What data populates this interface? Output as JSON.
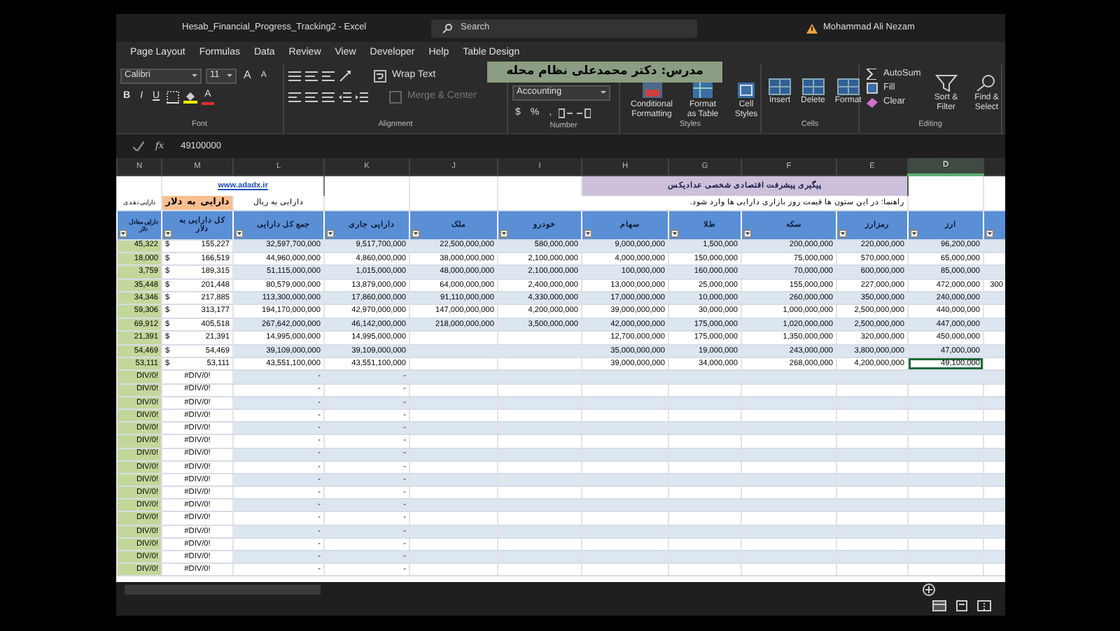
{
  "window": {
    "title": "Hesab_Financial_Progress_Tracking2 - Excel"
  },
  "search": {
    "placeholder": "Search"
  },
  "account": {
    "name": "Mohammad Ali Nezam"
  },
  "ribbon_tabs": [
    {
      "label": "Page Layout"
    },
    {
      "label": "Formulas"
    },
    {
      "label": "Data"
    },
    {
      "label": "Review"
    },
    {
      "label": "View"
    },
    {
      "label": "Developer"
    },
    {
      "label": "Help"
    },
    {
      "label": "Table Design"
    }
  ],
  "instructor_caption": "مدرس: دکتر محمدعلی نظام محله",
  "font_group": {
    "label": "Font",
    "font_name": "Calibri",
    "font_size": "11",
    "grow": "A",
    "shrink": "A",
    "bold": "B",
    "italic": "I",
    "underline": "U",
    "font_color": "A"
  },
  "alignment_group": {
    "label": "Alignment",
    "wrap_text": "Wrap Text",
    "merge": "Merge & Center",
    "merge_disabled": true
  },
  "number_group": {
    "label": "Number",
    "format": "Accounting",
    "currency": "$",
    "percent": "%",
    "comma": ","
  },
  "styles_group": {
    "label": "Styles",
    "buttons": [
      "Conditional Formatting",
      "Format as Table",
      "Cell Styles"
    ]
  },
  "cells_group": {
    "label": "Cells",
    "buttons": [
      "Insert",
      "Delete",
      "Format"
    ]
  },
  "editing_group": {
    "label": "Editing",
    "small_buttons": [
      {
        "kind": "sum",
        "label": "AutoSum"
      },
      {
        "kind": "fill",
        "label": "Fill"
      },
      {
        "kind": "clear",
        "label": "Clear"
      }
    ],
    "large_buttons": [
      {
        "kind": "sort",
        "label": "Sort & Filter"
      },
      {
        "kind": "find",
        "label": "Find & Select"
      }
    ]
  },
  "formula_bar": {
    "function_label": "fx",
    "value": "49100000"
  },
  "sheet": {
    "banner_link": "www.adadx.ir",
    "banner_title": "پیگیری پیشرفت اقتصادی شخصی عدادیکس",
    "note": "راهنما: در این ستون ها قیمت روز بازاری دارایی ها وارد شود.",
    "columns": [
      {
        "label": "N",
        "selected": false,
        "subheader": "دارایی نقدی",
        "heading": "دارایی معادل دلار"
      },
      {
        "label": "M",
        "selected": false,
        "subheader": "دارایی به دلار",
        "heading": "کل دارایی به دلار"
      },
      {
        "label": "L",
        "selected": false,
        "subheader": "دارایی به ریال",
        "heading": "جمع کل دارایی"
      },
      {
        "label": "K",
        "selected": false,
        "heading": "دارایی جاری"
      },
      {
        "label": "J",
        "selected": false,
        "heading": "ملک"
      },
      {
        "label": "I",
        "selected": false,
        "heading": "خودرو"
      },
      {
        "label": "H",
        "selected": false,
        "heading": "سهام"
      },
      {
        "label": "G",
        "selected": false,
        "heading": "طلا"
      },
      {
        "label": "F",
        "selected": false,
        "heading": "سکه"
      },
      {
        "label": "E",
        "selected": false,
        "heading": "رمزارز"
      },
      {
        "label": "D",
        "selected": true,
        "heading": "ارز"
      }
    ],
    "rows": [
      {
        "selected": false,
        "currency": "$",
        "cells": [
          "45,322",
          "155,227",
          "32,597,700,000",
          "9,517,700,000",
          "22,500,000,000",
          "580,000,000",
          "9,000,000,000",
          "1,500,000",
          "200,000,000",
          "220,000,000",
          "96,200,000"
        ]
      },
      {
        "selected": false,
        "currency": "$",
        "cells": [
          "18,000",
          "166,519",
          "44,960,000,000",
          "4,860,000,000",
          "38,000,000,000",
          "2,100,000,000",
          "4,000,000,000",
          "150,000,000",
          "75,000,000",
          "570,000,000",
          "65,000,000"
        ]
      },
      {
        "selected": false,
        "currency": "$",
        "cells": [
          "3,759",
          "189,315",
          "51,115,000,000",
          "1,015,000,000",
          "48,000,000,000",
          "2,100,000,000",
          "100,000,000",
          "160,000,000",
          "70,000,000",
          "600,000,000",
          "85,000,000"
        ]
      },
      {
        "selected": false,
        "currency": "$",
        "cells": [
          "35,448",
          "201,448",
          "80,579,000,000",
          "13,879,000,000",
          "64,000,000,000",
          "2,400,000,000",
          "13,000,000,000",
          "25,000,000",
          "155,000,000",
          "227,000,000",
          "472,000,000"
        ],
        "overflow_cell": "300"
      },
      {
        "selected": false,
        "currency": "$",
        "cells": [
          "34,346",
          "217,885",
          "113,300,000,000",
          "17,860,000,000",
          "91,110,000,000",
          "4,330,000,000",
          "17,000,000,000",
          "10,000,000",
          "260,000,000",
          "350,000,000",
          "240,000,000"
        ]
      },
      {
        "selected": false,
        "currency": "$",
        "cells": [
          "59,306",
          "313,177",
          "194,170,000,000",
          "42,970,000,000",
          "147,000,000,000",
          "4,200,000,000",
          "39,000,000,000",
          "30,000,000",
          "1,000,000,000",
          "2,500,000,000",
          "440,000,000"
        ]
      },
      {
        "selected": false,
        "currency": "$",
        "cells": [
          "69,912",
          "405,518",
          "267,642,000,000",
          "46,142,000,000",
          "218,000,000,000",
          "3,500,000,000",
          "42,000,000,000",
          "175,000,000",
          "1,020,000,000",
          "2,500,000,000",
          "447,000,000"
        ]
      },
      {
        "selected": false,
        "currency": "$",
        "cells": [
          "21,391",
          "21,391",
          "14,995,000,000",
          "14,995,000,000",
          null,
          null,
          "12,700,000,000",
          "175,000,000",
          "1,350,000,000",
          "320,000,000",
          "450,000,000"
        ]
      },
      {
        "selected": false,
        "currency": "$",
        "cells": [
          "54,469",
          "54,469",
          "39,109,000,000",
          "39,109,000,000",
          null,
          null,
          "35,000,000,000",
          "19,000,000",
          "243,000,000",
          "3,800,000,000",
          "47,000,000"
        ]
      },
      {
        "selected": true,
        "currency": "$",
        "cells": [
          "53,111",
          "53,111",
          "43,551,100,000",
          "43,551,100,000",
          null,
          null,
          "39,000,000,000",
          "34,000,000",
          "268,000,000",
          "4,200,000,000",
          "49,100,000"
        ]
      },
      {
        "selected": false,
        "cells": [
          "DIV/0!",
          "#DIV/0!",
          "-",
          "-"
        ]
      },
      {
        "selected": false,
        "cells": [
          "DIV/0!",
          "#DIV/0!",
          "-",
          "-"
        ]
      },
      {
        "selected": false,
        "cells": [
          "DIV/0!",
          "#DIV/0!",
          "-",
          "-"
        ]
      },
      {
        "selected": false,
        "cells": [
          "DIV/0!",
          "#DIV/0!",
          "-",
          "-"
        ]
      },
      {
        "selected": false,
        "cells": [
          "DIV/0!",
          "#DIV/0!",
          "-",
          "-"
        ]
      },
      {
        "selected": false,
        "cells": [
          "DIV/0!",
          "#DIV/0!",
          "-",
          "-"
        ]
      },
      {
        "selected": false,
        "cells": [
          "DIV/0!",
          "#DIV/0!",
          "-",
          "-"
        ]
      },
      {
        "selected": false,
        "cells": [
          "DIV/0!",
          "#DIV/0!",
          "-",
          "-"
        ]
      },
      {
        "selected": false,
        "cells": [
          "DIV/0!",
          "#DIV/0!",
          "-",
          "-"
        ]
      },
      {
        "selected": false,
        "cells": [
          "DIV/0!",
          "#DIV/0!",
          "-",
          "-"
        ]
      },
      {
        "selected": false,
        "cells": [
          "DIV/0!",
          "#DIV/0!",
          "-",
          "-"
        ]
      },
      {
        "selected": false,
        "cells": [
          "DIV/0!",
          "#DIV/0!",
          "-",
          "-"
        ]
      },
      {
        "selected": false,
        "cells": [
          "DIV/0!",
          "#DIV/0!",
          "-",
          "-"
        ]
      },
      {
        "selected": false,
        "cells": [
          "DIV/0!",
          "#DIV/0!",
          "-",
          "-"
        ]
      },
      {
        "selected": false,
        "cells": [
          "DIV/0!",
          "#DIV/0!",
          "-",
          "-"
        ]
      },
      {
        "selected": false,
        "cells": [
          "DIV/0!",
          "#DIV/0!",
          "-",
          "-"
        ]
      }
    ]
  },
  "status_bar": {
    "views": [
      {
        "kind": "normal",
        "selected": true
      },
      {
        "kind": "layout",
        "selected": false
      },
      {
        "kind": "break",
        "selected": false
      }
    ]
  }
}
